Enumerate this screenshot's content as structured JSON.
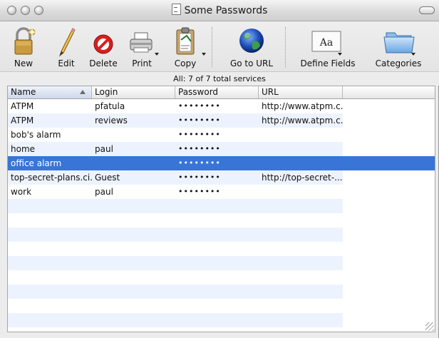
{
  "window": {
    "title": "Some Passwords"
  },
  "toolbar": {
    "buttons": [
      {
        "label": "New",
        "icon": "lock-icon"
      },
      {
        "label": "Edit",
        "icon": "pencil-icon"
      },
      {
        "label": "Delete",
        "icon": "delete-icon"
      },
      {
        "label": "Print",
        "icon": "printer-icon"
      },
      {
        "label": "Copy",
        "icon": "clipboard-icon"
      },
      {
        "label": "Go to URL",
        "icon": "globe-icon"
      },
      {
        "label": "Define Fields",
        "icon": "font-icon"
      },
      {
        "label": "Categories",
        "icon": "folder-icon"
      }
    ]
  },
  "status": {
    "text": "All: 7 of 7 total services"
  },
  "table": {
    "columns": [
      "Name",
      "Login",
      "Password",
      "URL"
    ],
    "sorted_column": "Name",
    "rows": [
      {
        "name": "ATPM",
        "login": "pfatula",
        "password": "••••••••",
        "url": "http://www.atpm.c..."
      },
      {
        "name": "ATPM",
        "login": "reviews",
        "password": "••••••••",
        "url": "http://www.atpm.c..."
      },
      {
        "name": "bob's alarm",
        "login": "",
        "password": "••••••••",
        "url": ""
      },
      {
        "name": "home",
        "login": "paul",
        "password": "••••••••",
        "url": ""
      },
      {
        "name": "office alarm",
        "login": "",
        "password": "••••••••",
        "url": ""
      },
      {
        "name": "top-secret-plans.ci...",
        "login": "Guest",
        "password": "••••••••",
        "url": "http://top-secret-..."
      },
      {
        "name": "work",
        "login": "paul",
        "password": "••••••••",
        "url": ""
      }
    ],
    "selected_row": 4
  },
  "colors": {
    "selection": "#3875d7",
    "stripe": "#edf3fe"
  }
}
